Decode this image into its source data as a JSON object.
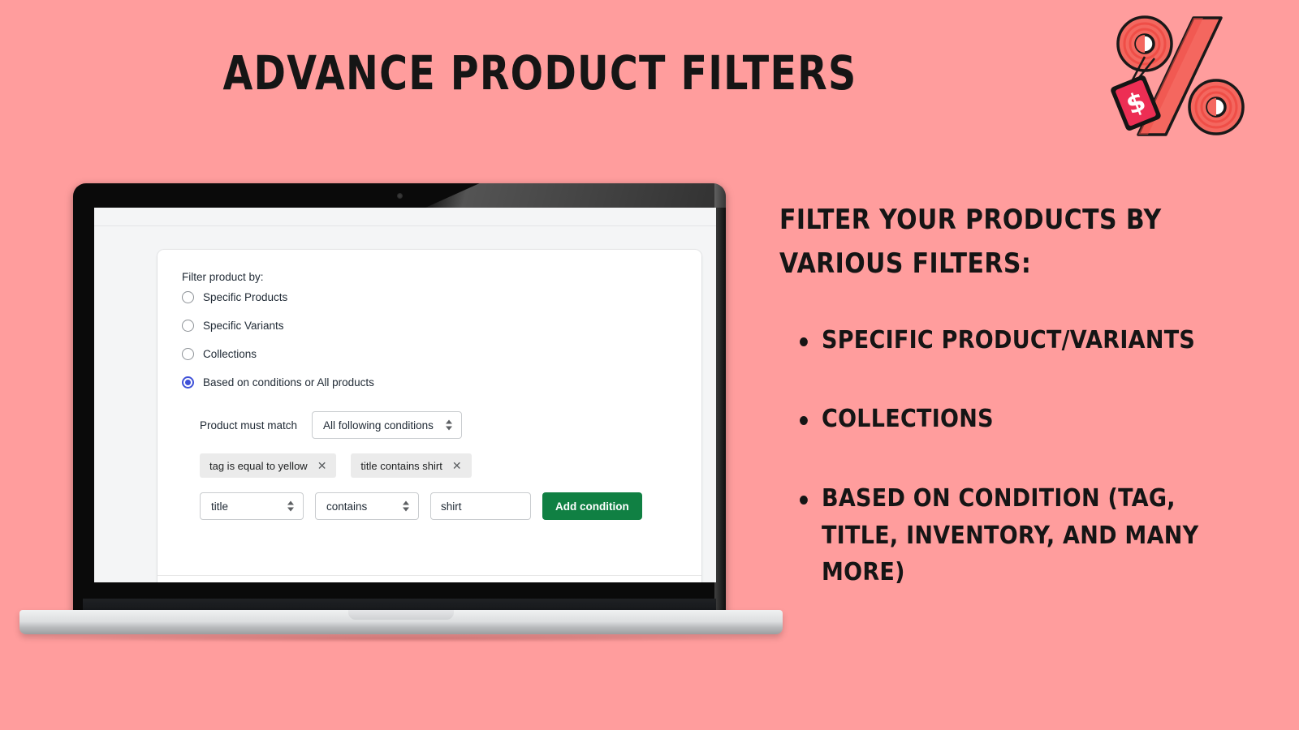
{
  "theme": {
    "background": "#ff9d9d",
    "accent_green": "#108043",
    "accent_blue": "#3f51d8",
    "text_dark": "#151515",
    "icon_red": "#f0524d"
  },
  "header": {
    "title": "ADVANCE PRODUCT FILTERS",
    "icon": "percent-discount-tag-icon"
  },
  "laptop": {
    "screen": {
      "card": {
        "filter_label": "Filter product by:",
        "radio_options": [
          {
            "label": "Specific Products",
            "selected": false
          },
          {
            "label": "Specific Variants",
            "selected": false
          },
          {
            "label": "Collections",
            "selected": false
          },
          {
            "label": "Based on conditions or All products",
            "selected": true
          }
        ],
        "conditions": {
          "match_label": "Product must match",
          "match_select_value": "All following conditions",
          "chips": [
            {
              "label": "tag is equal to yellow",
              "close": "✕"
            },
            {
              "label": "title contains shirt",
              "close": "✕"
            }
          ],
          "builder": {
            "field_select_value": "title",
            "operator_select_value": "contains",
            "value_input_value": "shirt",
            "add_button_label": "Add condition"
          }
        }
      }
    }
  },
  "right_panel": {
    "heading_line1": "FILTER YOUR PRODUCTS BY",
    "heading_line2": "VARIOUS FILTERS:",
    "bullets": [
      "SPECIFIC PRODUCT/VARIANTS",
      "COLLECTIONS",
      "BASED ON CONDITION (TAG, TITLE, INVENTORY, AND MANY MORE)"
    ]
  }
}
